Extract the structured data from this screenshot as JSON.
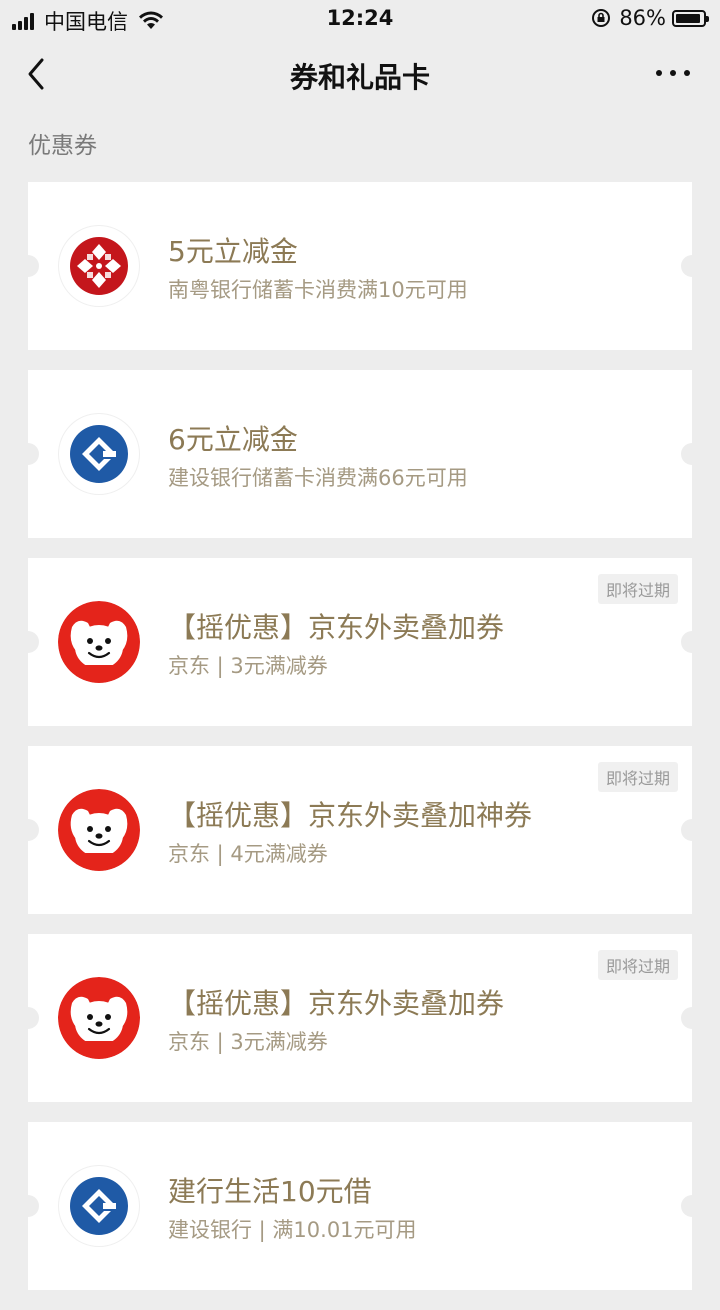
{
  "status_bar": {
    "carrier": "中国电信",
    "time": "12:24",
    "battery_pct": "86%"
  },
  "nav": {
    "title": "券和礼品卡",
    "back_icon": "chevron-left-icon",
    "more_icon": "more-dots-icon"
  },
  "section": {
    "title": "优惠券"
  },
  "coupons": [
    {
      "logo": "nanyue-bank-logo",
      "title": "5元立减金",
      "subtitle": "南粤银行储蓄卡消费满10元可用",
      "badge": ""
    },
    {
      "logo": "ccb-logo",
      "title": "6元立减金",
      "subtitle": "建设银行储蓄卡消费满66元可用",
      "badge": ""
    },
    {
      "logo": "jd-dog-logo",
      "title": "【摇优惠】京东外卖叠加券",
      "subtitle": "京东 | 3元满减券",
      "badge": "即将过期"
    },
    {
      "logo": "jd-dog-logo",
      "title": "【摇优惠】京东外卖叠加神券",
      "subtitle": "京东 | 4元满减券",
      "badge": "即将过期"
    },
    {
      "logo": "jd-dog-logo",
      "title": "【摇优惠】京东外卖叠加券",
      "subtitle": "京东 | 3元满减券",
      "badge": "即将过期"
    },
    {
      "logo": "ccb-logo",
      "title": "建行生活10元借",
      "subtitle": "建设银行 | 满10.01元可用",
      "badge": ""
    }
  ],
  "colors": {
    "background": "#ededed",
    "title_gold": "#8c7a55",
    "jd_red": "#e4241b",
    "ccb_blue": "#1f5aa6"
  }
}
